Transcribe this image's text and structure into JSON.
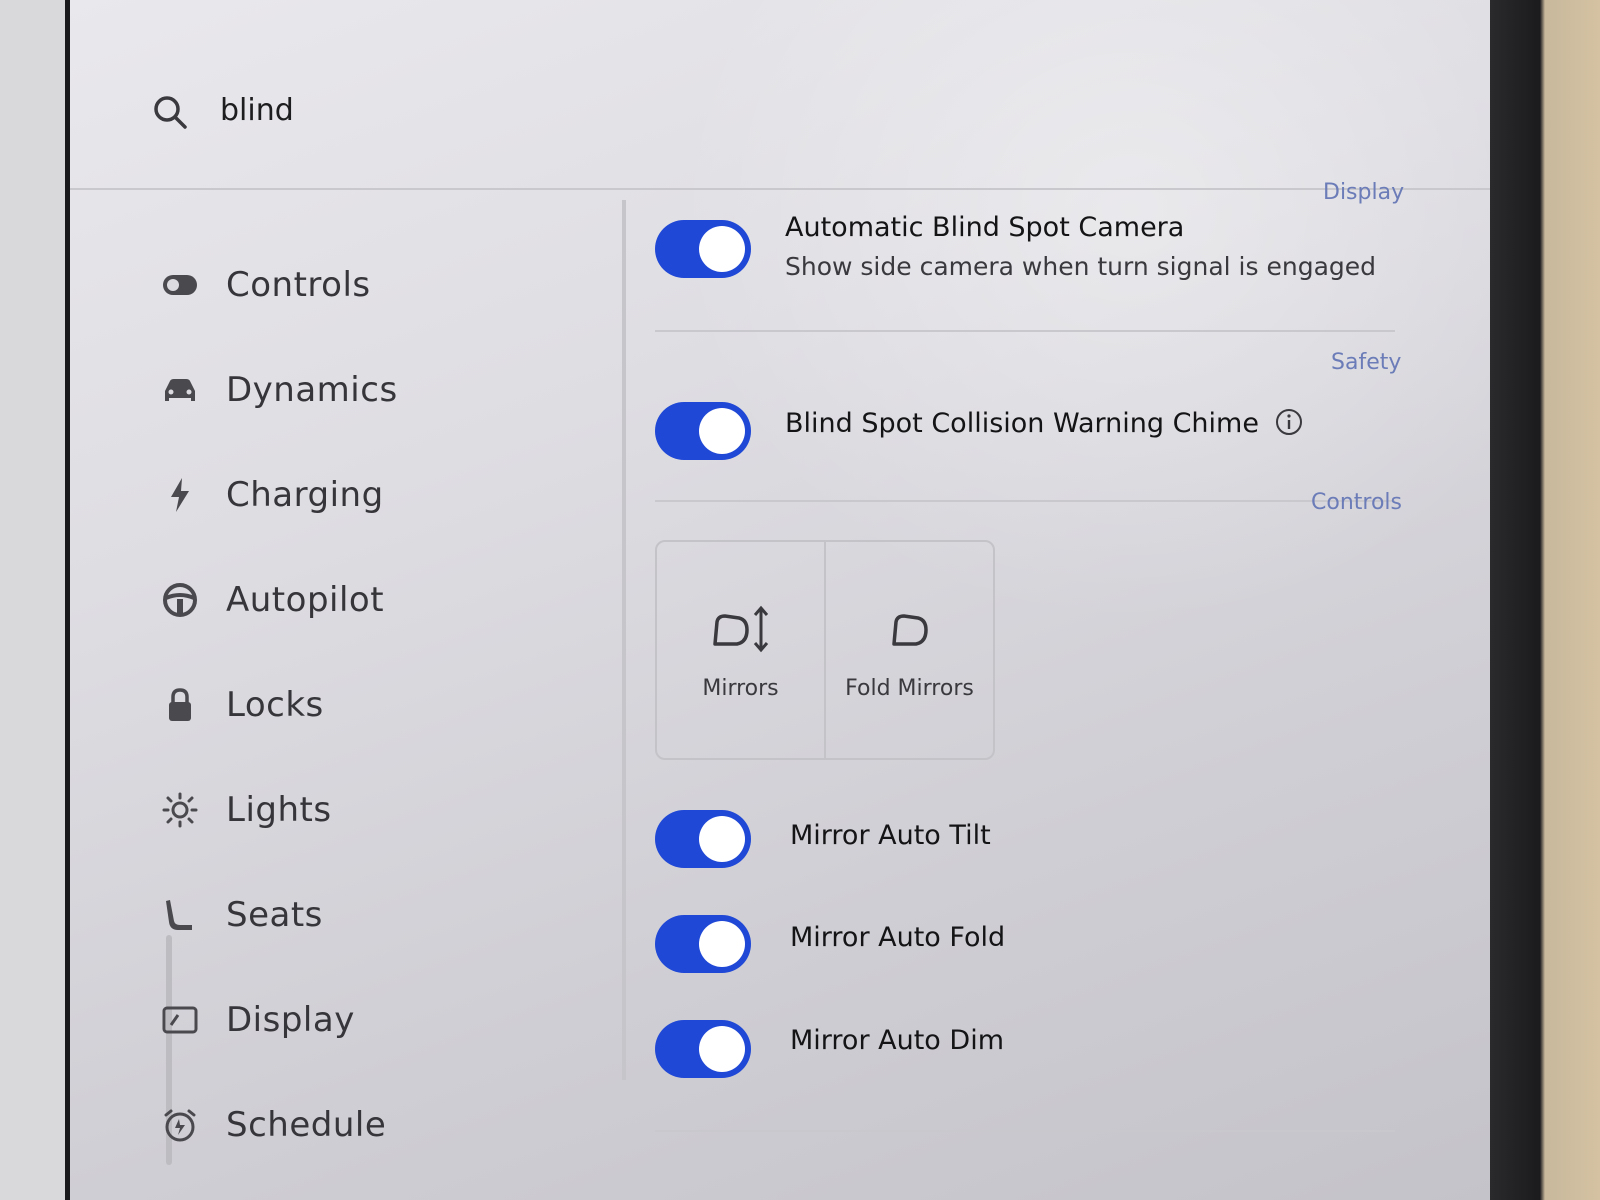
{
  "search": {
    "value": "blind",
    "icon": "search-icon"
  },
  "sidebar": {
    "items": [
      {
        "label": "Controls",
        "icon": "toggle-icon"
      },
      {
        "label": "Dynamics",
        "icon": "car-icon"
      },
      {
        "label": "Charging",
        "icon": "lightning-icon"
      },
      {
        "label": "Autopilot",
        "icon": "steering-wheel-icon"
      },
      {
        "label": "Locks",
        "icon": "lock-icon"
      },
      {
        "label": "Lights",
        "icon": "light-icon"
      },
      {
        "label": "Seats",
        "icon": "seat-icon"
      },
      {
        "label": "Display",
        "icon": "display-icon"
      },
      {
        "label": "Schedule",
        "icon": "alarm-clock-icon"
      }
    ]
  },
  "results": {
    "blind_spot_camera": {
      "section": "Display",
      "title": "Automatic Blind Spot Camera",
      "subtitle": "Show side camera when turn signal is engaged",
      "enabled": true
    },
    "collision_chime": {
      "section": "Safety",
      "title": "Blind Spot Collision Warning Chime",
      "enabled": true
    },
    "controls_section": "Controls",
    "tiles": [
      {
        "label": "Mirrors",
        "icon": "mirror-adjust-icon"
      },
      {
        "label": "Fold Mirrors",
        "icon": "mirror-fold-icon"
      }
    ],
    "mirror_toggles": [
      {
        "label": "Mirror Auto Tilt",
        "enabled": true
      },
      {
        "label": "Mirror Auto Fold",
        "enabled": true
      },
      {
        "label": "Mirror Auto Dim",
        "enabled": true
      }
    ]
  },
  "colors": {
    "accent": "#1f48d6",
    "section_tag": "#6b7cb8",
    "background": "#e4e3e7"
  }
}
